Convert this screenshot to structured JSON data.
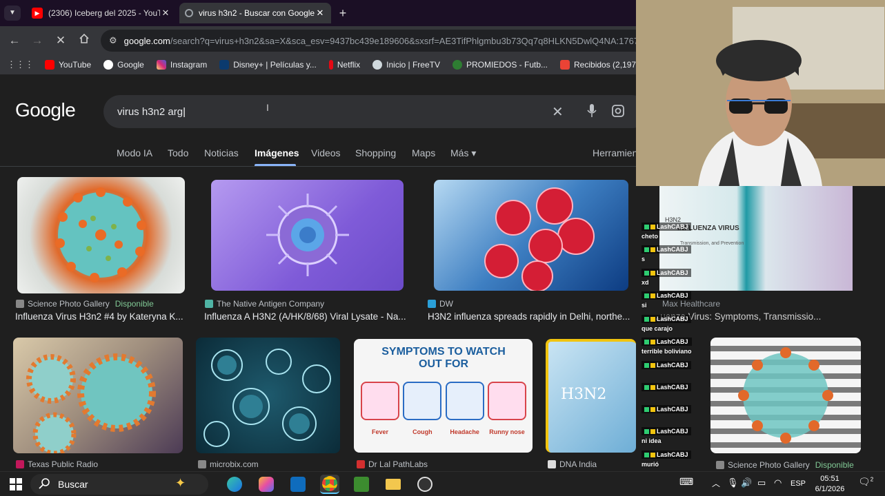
{
  "browser": {
    "tabs": [
      {
        "title": "(2306) Iceberg del 2025 - YouTu",
        "active": false
      },
      {
        "title": "virus h3n2 - Buscar con Google",
        "active": true
      }
    ],
    "url_host": "google.com",
    "url_rest": "/search?q=virus+h3n2&sa=X&sca_esv=9437bc439e189606&sxsrf=AE3TifPhlgmbu3b73Qq7q8HLKN5DwlQ4NA:1767",
    "bookmarks": [
      {
        "label": "YouTube",
        "color": "#ff0000"
      },
      {
        "label": "Google",
        "color": "#4285f4"
      },
      {
        "label": "Instagram",
        "color": "#d62976"
      },
      {
        "label": "Disney+ | Películas y...",
        "color": "#0b3a6e"
      },
      {
        "label": "Netflix",
        "color": "#e50914"
      },
      {
        "label": "Inicio | FreeTV",
        "color": "#cfd8dc"
      },
      {
        "label": "PROMIEDOS - Futb...",
        "color": "#2e7d32"
      },
      {
        "label": "Recibidos (2,197) -...",
        "color": "#ea4335"
      }
    ]
  },
  "google": {
    "logo": "Google",
    "query": "virus h3n2 arg",
    "tabs": [
      "Modo IA",
      "Todo",
      "Noticias",
      "Imágenes",
      "Videos",
      "Shopping",
      "Maps",
      "Más ▾",
      "Herramien"
    ],
    "active_tab": "Imágenes",
    "row1": [
      {
        "source": "Science Photo Gallery",
        "available": "Disponible",
        "caption": "Influenza Virus H3n2 #4 by Kateryna K..."
      },
      {
        "source": "The Native Antigen Company",
        "available": "",
        "caption": "Influenza A H3N2 (A/HK/8/68) Viral Lysate - Na..."
      },
      {
        "source": "DW",
        "available": "",
        "caption": "H3N2 influenza spreads rapidly in Delhi, northe..."
      }
    ],
    "row2_sources": [
      "Texas Public Radio",
      "microbix.com",
      "Dr Lal PathLabs",
      "DNA India"
    ],
    "symptoms": {
      "title": "SYMPTOMS TO WATCH OUT FOR",
      "items": [
        "Fever",
        "Cough",
        "Headache",
        "Runny nose"
      ]
    },
    "dna_label": "H3N2"
  },
  "overlay": {
    "card_h3n2": "H3N2",
    "card_title": "INFLUENZA VIRUS",
    "card_sub": "Transmission, and Prevention",
    "right_source": "Max Healthcare",
    "right_caption": "...uenza Virus: Symptoms, Transmissio...",
    "right_bottom_source": "Science Photo Gallery",
    "right_bottom_avail": "Disponible",
    "chat": [
      {
        "user": "LashCABJ",
        "text": "cheto"
      },
      {
        "user": "LashCABJ",
        "text": "s"
      },
      {
        "user": "LashCABJ",
        "text": "xd"
      },
      {
        "user": "LashCABJ",
        "text": "si"
      },
      {
        "user": "LashCABJ",
        "text": "que carajo"
      },
      {
        "user": "LashCABJ",
        "text": "terrible boliviano"
      },
      {
        "user": "LashCABJ",
        "text": ""
      },
      {
        "user": "LashCABJ",
        "text": ""
      },
      {
        "user": "LashCABJ",
        "text": ""
      },
      {
        "user": "LashCABJ",
        "text": "ni idea"
      },
      {
        "user": "LashCABJ",
        "text": "murió"
      }
    ]
  },
  "taskbar": {
    "search_label": "Buscar",
    "lang": "ESP",
    "time": "05:51",
    "date": "6/1/2026",
    "notifications": "2"
  }
}
